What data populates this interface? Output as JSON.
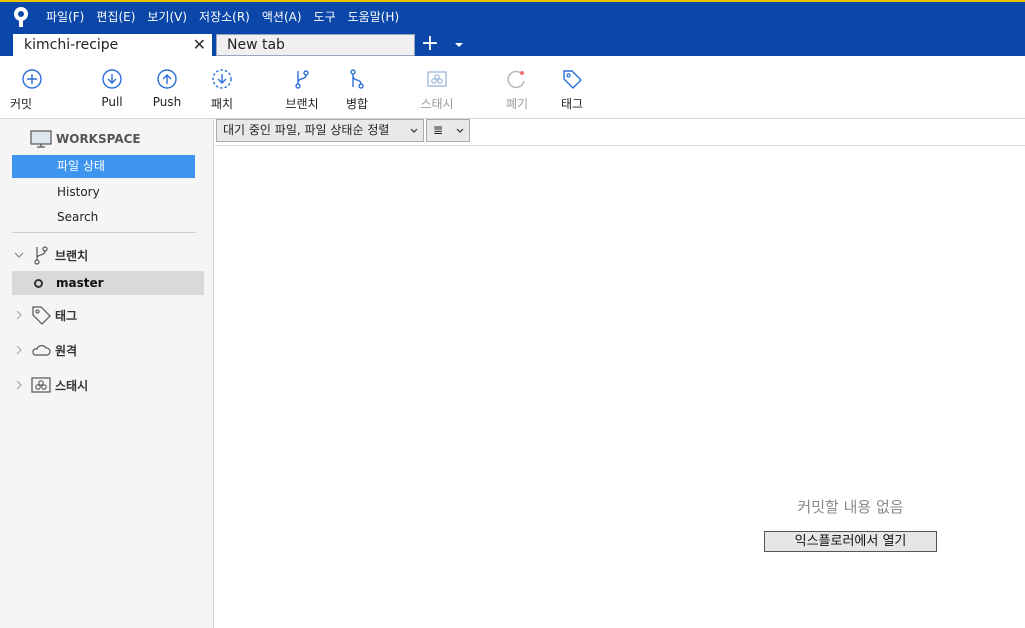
{
  "menu": [
    "파일(F)",
    "편집(E)",
    "보기(V)",
    "저장소(R)",
    "액션(A)",
    "도구",
    "도움말(H)"
  ],
  "tabs": [
    {
      "label": "kimchi-recipe",
      "active": true
    },
    {
      "label": "New tab",
      "active": false
    }
  ],
  "tab_add_label": "+",
  "tab_close_label": "✕",
  "toolbar": {
    "commit": "커밋",
    "pull": "Pull",
    "push": "Push",
    "fetch": "패치",
    "branch": "브랜치",
    "merge": "병합",
    "stash": "스태시",
    "discard": "폐기",
    "tag": "태그"
  },
  "sidebar": {
    "workspace_label": "WORKSPACE",
    "workspace_items": [
      "파일 상태",
      "History",
      "Search"
    ],
    "selected_item": "파일 상태",
    "branches_label": "브랜치",
    "current_branch": "master",
    "tags_label": "태그",
    "remotes_label": "원격",
    "stashes_label": "스태시"
  },
  "filters": {
    "sort_select": "대기 중인 파일, 파일 상태순 정렬",
    "view_select": "≣"
  },
  "main": {
    "empty_message": "커밋할 내용 없음",
    "open_explorer_button": "익스플로러에서 열기"
  },
  "colors": {
    "titlebar": "#0a47a9",
    "accent": "#3d95f0",
    "disabled": "#9a9a9a"
  }
}
